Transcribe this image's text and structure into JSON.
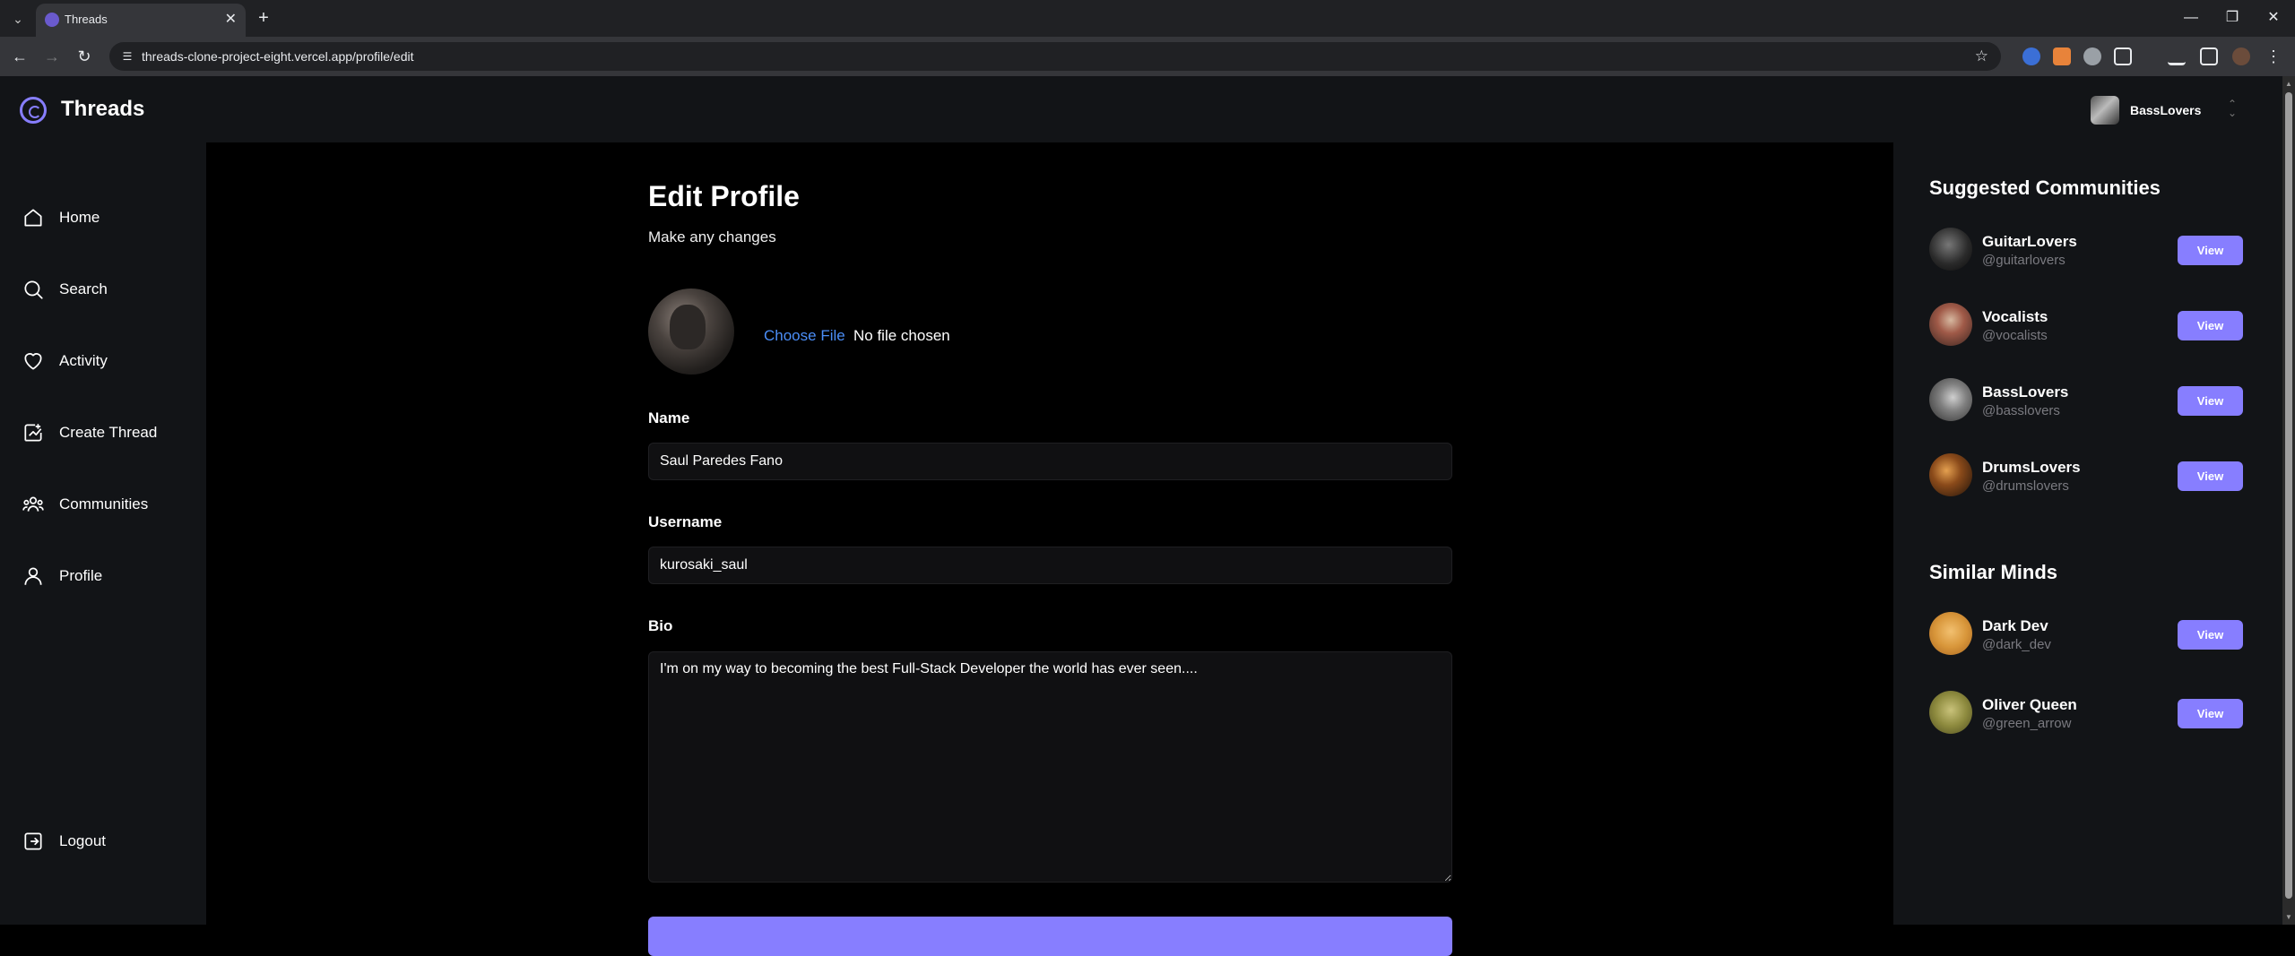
{
  "browser": {
    "tab_title": "Threads",
    "url": "threads-clone-project-eight.vercel.app/profile/edit"
  },
  "app": {
    "logo_text": "Threads",
    "current_user": "BassLovers",
    "accent_color": "#877eff"
  },
  "sidebar": {
    "items": [
      {
        "label": "Home",
        "icon": "home-icon"
      },
      {
        "label": "Search",
        "icon": "search-icon"
      },
      {
        "label": "Activity",
        "icon": "heart-icon"
      },
      {
        "label": "Create Thread",
        "icon": "create-thread-icon"
      },
      {
        "label": "Communities",
        "icon": "communities-icon"
      },
      {
        "label": "Profile",
        "icon": "user-icon"
      }
    ],
    "logout_label": "Logout"
  },
  "form": {
    "title": "Edit Profile",
    "subtitle": "Make any changes",
    "choose_file": "Choose File",
    "no_file": "No file chosen",
    "name_label": "Name",
    "name_value": "Saul Paredes Fano",
    "username_label": "Username",
    "username_value": "kurosaki_saul",
    "bio_label": "Bio",
    "bio_value": "I'm on my way to becoming the best Full-Stack Developer the world has ever seen...."
  },
  "right_sidebar": {
    "communities_title": "Suggested Communities",
    "communities": [
      {
        "name": "GuitarLovers",
        "handle": "@guitarlovers",
        "button": "View"
      },
      {
        "name": "Vocalists",
        "handle": "@vocalists",
        "button": "View"
      },
      {
        "name": "BassLovers",
        "handle": "@basslovers",
        "button": "View"
      },
      {
        "name": "DrumsLovers",
        "handle": "@drumslovers",
        "button": "View"
      }
    ],
    "similar_title": "Similar Minds",
    "users": [
      {
        "name": "Dark Dev",
        "handle": "@dark_dev",
        "button": "View"
      },
      {
        "name": "Oliver Queen",
        "handle": "@green_arrow",
        "button": "View"
      }
    ]
  }
}
